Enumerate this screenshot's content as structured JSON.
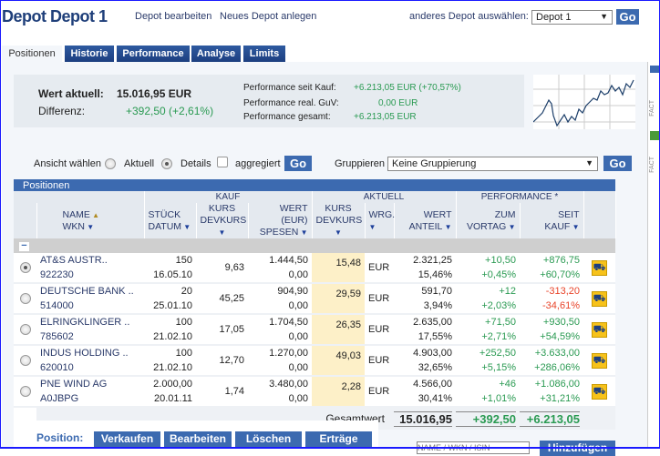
{
  "header": {
    "title": "Depot Depot 1",
    "edit_link": "Depot bearbeiten",
    "new_link": "Neues Depot anlegen",
    "select_label": "anderes Depot auswählen:",
    "select_value": "Depot 1",
    "go": "Go"
  },
  "tabs": [
    "Positionen",
    "Historie",
    "Performance",
    "Analyse",
    "Limits"
  ],
  "summary": {
    "wert_label": "Wert aktuell:",
    "wert": "15.016,95 EUR",
    "diff_label": "Differenz:",
    "diff": "+392,50 (+2,61%)",
    "perf": [
      {
        "label": "Performance seit Kauf:",
        "value": "+6.213,05 EUR (+70,57%)"
      },
      {
        "label": "Performance real. GuV:",
        "value": "0,00 EUR"
      },
      {
        "label": "Performance gesamt:",
        "value": "+6.213,05 EUR"
      }
    ]
  },
  "view": {
    "label": "Ansicht wählen",
    "opt1": "Aktuell",
    "opt2": "Details",
    "check": "aggregiert",
    "go": "Go",
    "group_label": "Gruppieren",
    "group_value": "Keine Gruppierung"
  },
  "table": {
    "title": "Positionen",
    "groups": [
      "KAUF",
      "AKTUELL",
      "PERFORMANCE *"
    ],
    "cols": [
      [
        "NAME",
        "WKN"
      ],
      [
        "STÜCK",
        "DATUM"
      ],
      [
        "KURS",
        "DEVKURS"
      ],
      [
        "WERT (EUR)",
        "SPESEN"
      ],
      [
        "KURS",
        "DEVKURS"
      ],
      [
        "WRG.",
        ""
      ],
      [
        "WERT",
        "ANTEIL"
      ],
      [
        "ZUM",
        "VORTAG"
      ],
      [
        "SEIT",
        "KAUF"
      ]
    ],
    "rows": [
      {
        "name": "AT&S AUSTR..",
        "wkn": "922230",
        "stueck": "150",
        "datum": "16.05.10",
        "kurs": "9,63",
        "wert": "1.444,50",
        "spesen": "0,00",
        "akt": "15,48",
        "wrg": "EUR",
        "wert_akt": "2.321,25",
        "anteil": "15,46%",
        "vortag": "+10,50",
        "vortag_pct": "+0,45%",
        "kauf": "+876,75",
        "kauf_pct": "+60,70%",
        "neg": false,
        "selected": true
      },
      {
        "name": "DEUTSCHE BANK ..",
        "wkn": "514000",
        "stueck": "20",
        "datum": "25.01.10",
        "kurs": "45,25",
        "wert": "904,90",
        "spesen": "0,00",
        "akt": "29,59",
        "wrg": "EUR",
        "wert_akt": "591,70",
        "anteil": "3,94%",
        "vortag": "+12",
        "vortag_pct": "+2,03%",
        "kauf": "-313,20",
        "kauf_pct": "-34,61%",
        "neg": true,
        "selected": false
      },
      {
        "name": "ELRINGKLINGER ..",
        "wkn": "785602",
        "stueck": "100",
        "datum": "21.02.10",
        "kurs": "17,05",
        "wert": "1.704,50",
        "spesen": "0,00",
        "akt": "26,35",
        "wrg": "EUR",
        "wert_akt": "2.635,00",
        "anteil": "17,55%",
        "vortag": "+71,50",
        "vortag_pct": "+2,71%",
        "kauf": "+930,50",
        "kauf_pct": "+54,59%",
        "neg": false,
        "selected": false
      },
      {
        "name": "INDUS HOLDING ..",
        "wkn": "620010",
        "stueck": "100",
        "datum": "21.02.10",
        "kurs": "12,70",
        "wert": "1.270,00",
        "spesen": "0,00",
        "akt": "49,03",
        "wrg": "EUR",
        "wert_akt": "4.903,00",
        "anteil": "32,65%",
        "vortag": "+252,50",
        "vortag_pct": "+5,15%",
        "kauf": "+3.633,00",
        "kauf_pct": "+286,06%",
        "neg": false,
        "selected": false
      },
      {
        "name": "PNE WIND AG",
        "wkn": "A0JBPG",
        "stueck": "2.000,00",
        "datum": "20.01.11",
        "kurs": "1,74",
        "wert": "3.480,00",
        "spesen": "0,00",
        "akt": "2,28",
        "wrg": "EUR",
        "wert_akt": "4.566,00",
        "anteil": "30,41%",
        "vortag": "+46",
        "vortag_pct": "+1,01%",
        "kauf": "+1.086,00",
        "kauf_pct": "+31,21%",
        "neg": false,
        "selected": false
      }
    ],
    "total_label": "Gesamtwert",
    "total": "15.016,95",
    "total_vortag": "+392,50",
    "total_kauf": "+6.213,05"
  },
  "bottom": {
    "label": "Position:",
    "buttons": [
      "Verkaufen",
      "Bearbeiten",
      "Löschen",
      "Erträge"
    ],
    "search_placeholder": "NAME / WKN / ISIN",
    "add": "Hinzufügen"
  },
  "side": {
    "text": "FACT"
  }
}
